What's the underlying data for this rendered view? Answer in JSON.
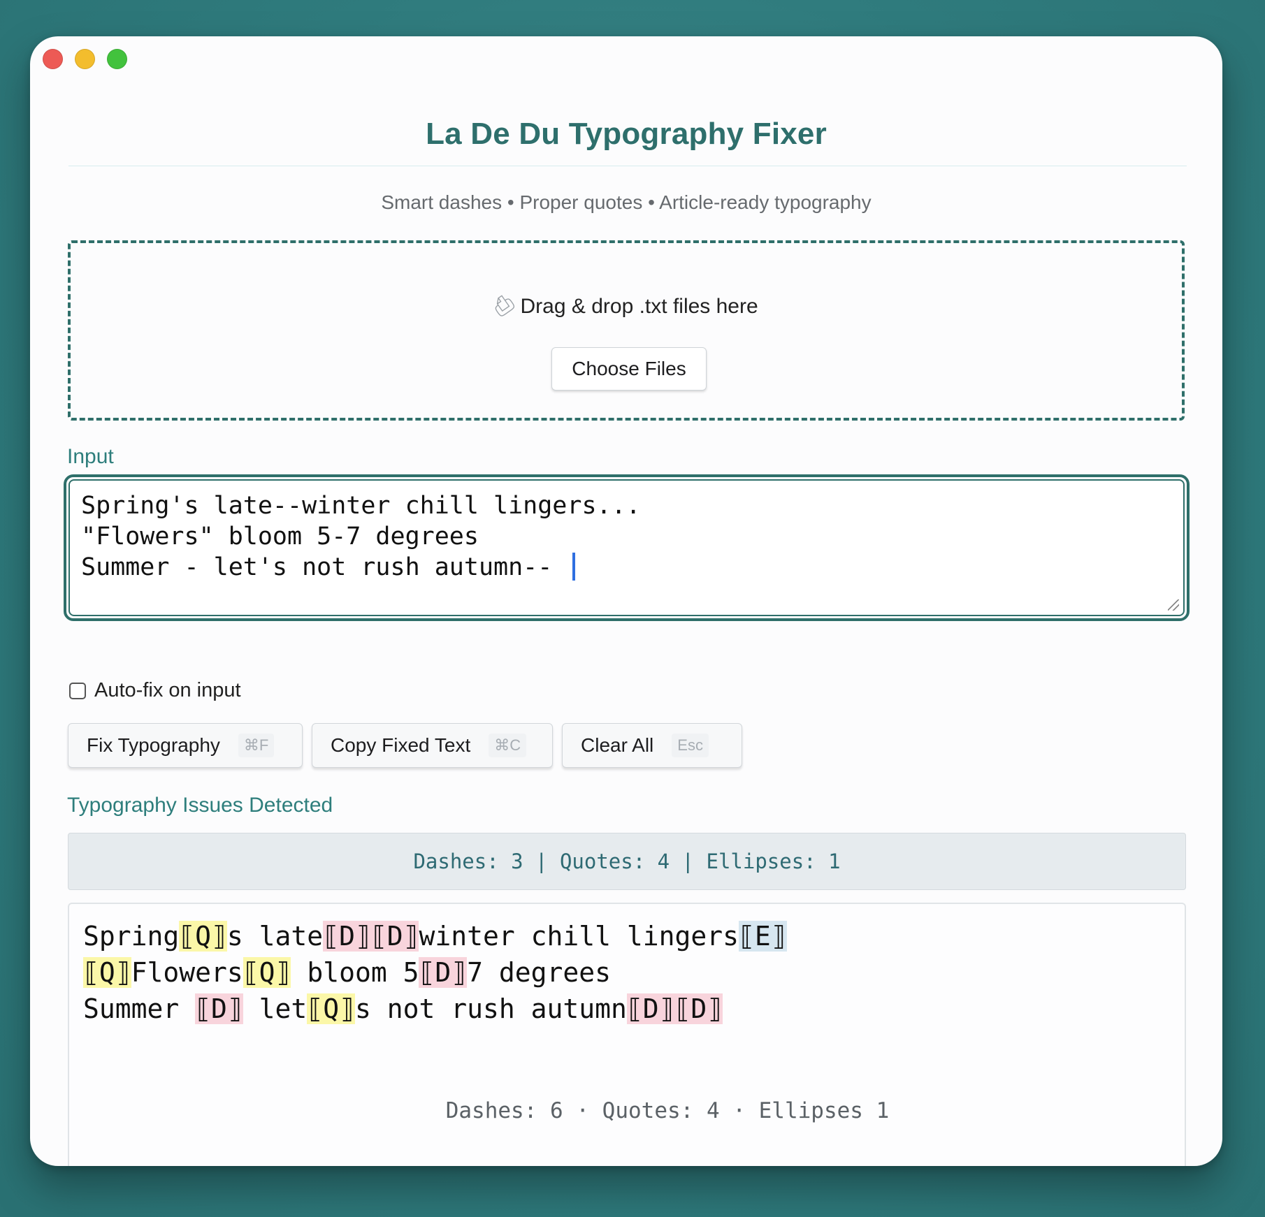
{
  "window": {
    "controls": [
      "close",
      "minimize",
      "zoom"
    ]
  },
  "header": {
    "title": "La De Du Typography Fixer",
    "subtitle": "Smart dashes • Proper quotes • Article-ready typography"
  },
  "dropzone": {
    "icon": "paperclip-icon",
    "text": "Drag & drop .txt files here",
    "choose_label": "Choose Files"
  },
  "input": {
    "label": "Input",
    "lines": [
      "Spring's late--winter chill lingers...",
      "\"Flowers\" bloom 5-7 degrees",
      "Summer - let's not rush autumn-- "
    ]
  },
  "options": {
    "autofix_label": "Auto-fix on input",
    "autofix_checked": false
  },
  "actions": {
    "fix_label": "Fix Typography",
    "fix_shortcut": "⌘F",
    "copy_label": "Copy Fixed Text",
    "copy_shortcut": "⌘C",
    "clear_label": "Clear All",
    "clear_shortcut": "Esc"
  },
  "issues": {
    "label": "Typography Issues Detected",
    "summary": "Dashes: 3 | Quotes: 4 | Ellipses: 1",
    "output_lines": [
      [
        {
          "t": "Spring",
          "k": ""
        },
        {
          "t": "⟦Q⟧",
          "k": "q"
        },
        {
          "t": "s late",
          "k": ""
        },
        {
          "t": "⟦D⟧⟦D⟧",
          "k": "d"
        },
        {
          "t": "winter chill lingers",
          "k": ""
        },
        {
          "t": "⟦E⟧",
          "k": "e"
        }
      ],
      [
        {
          "t": "⟦Q⟧",
          "k": "q"
        },
        {
          "t": "Flowers",
          "k": ""
        },
        {
          "t": "⟦Q⟧",
          "k": "q"
        },
        {
          "t": " bloom 5",
          "k": ""
        },
        {
          "t": "⟦D⟧",
          "k": "d"
        },
        {
          "t": "7 degrees",
          "k": ""
        }
      ],
      [
        {
          "t": "Summer ",
          "k": ""
        },
        {
          "t": "⟦D⟧",
          "k": "d"
        },
        {
          "t": " let",
          "k": ""
        },
        {
          "t": "⟦Q⟧",
          "k": "q"
        },
        {
          "t": "s not rush autumn",
          "k": ""
        },
        {
          "t": "⟦D⟧⟦D⟧",
          "k": "d"
        }
      ]
    ],
    "stats": "Dashes: 6 · Quotes: 4 · Ellipses 1"
  },
  "colors": {
    "accent": "#2e6f6a",
    "quote_highlight": "#fbf7a8",
    "dash_highlight": "#f8d4dc",
    "ellipsis_highlight": "#d6e6f0",
    "caret": "#2f6fe0"
  }
}
